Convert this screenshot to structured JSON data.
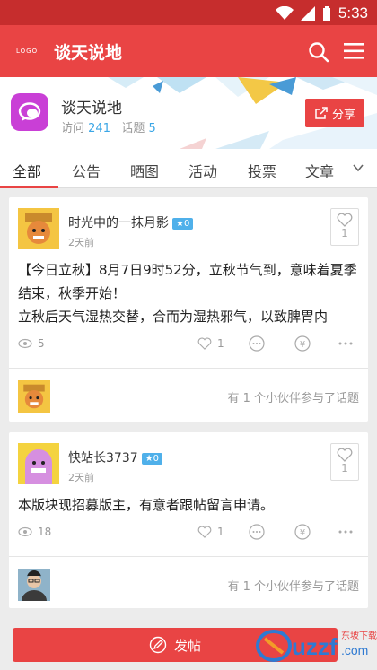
{
  "status": {
    "time": "5:33"
  },
  "appbar": {
    "logo": "LOGO",
    "title": "谈天说地"
  },
  "forum": {
    "name": "谈天说地",
    "visits_label": "访问",
    "visits": "241",
    "topics_label": "话题",
    "topics": "5",
    "share_label": "分享"
  },
  "tabs": [
    "全部",
    "公告",
    "晒图",
    "活动",
    "投票",
    "文章"
  ],
  "posts": [
    {
      "author": "时光中的一抹月影",
      "level": "0",
      "time": "2天前",
      "likes_box": "1",
      "content": "【今日立秋】8月7日9时52分，立秋节气到，意味着夏季结束，秋季开始！\n立秋后天气湿热交替，合而为湿热邪气，以致脾胃内",
      "views": "5",
      "likes": "1",
      "participants": "有 1 个小伙伴参与了话题"
    },
    {
      "author": "快站长3737",
      "level": "0",
      "time": "2天前",
      "likes_box": "1",
      "content": "本版块现招募版主，有意者跟帖留言申请。",
      "views": "18",
      "likes": "1",
      "participants": "有 1 个小伙伴参与了话题"
    }
  ],
  "post_button": "发帖",
  "watermark": "uzzf.com",
  "colors": {
    "primary": "#e94444",
    "accent": "#3aa6e6"
  }
}
